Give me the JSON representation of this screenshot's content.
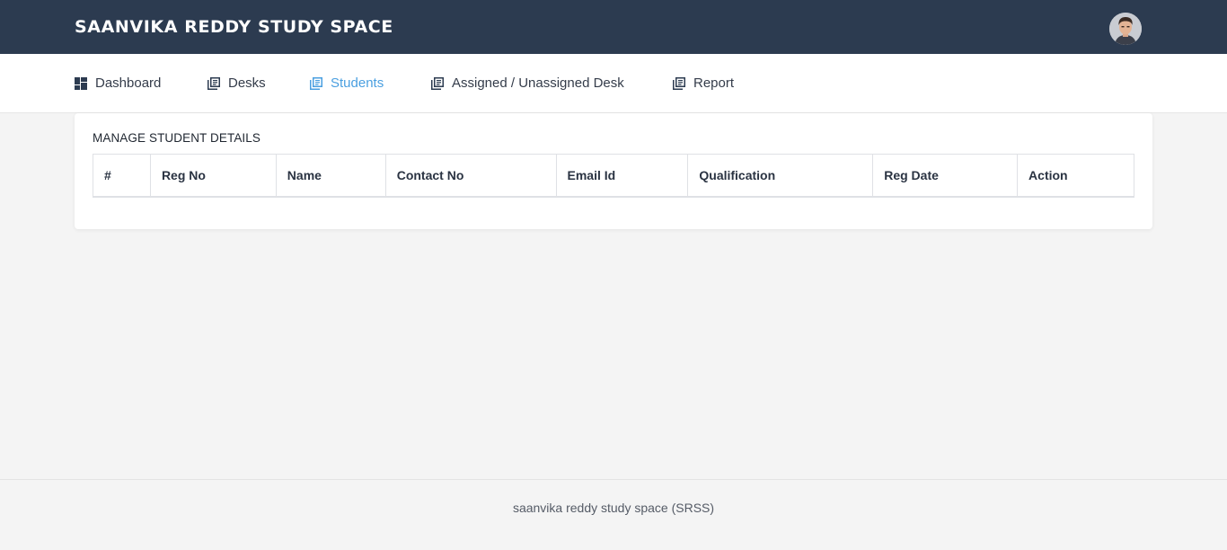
{
  "header": {
    "brand": "SAANVIKA REDDY STUDY SPACE",
    "avatar_icon": "user-avatar",
    "background_color": "#2c3b50"
  },
  "nav": {
    "items": [
      {
        "label": "Dashboard",
        "icon": "dashboard-icon",
        "active": false
      },
      {
        "label": "Desks",
        "icon": "library-books-icon",
        "active": false
      },
      {
        "label": "Students",
        "icon": "library-books-icon",
        "active": true
      },
      {
        "label": "Assigned / Unassigned Desk",
        "icon": "library-books-icon",
        "active": false
      },
      {
        "label": "Report",
        "icon": "library-books-icon",
        "active": false
      }
    ],
    "active_color": "#4a9fe0"
  },
  "main": {
    "card_title": "MANAGE STUDENT DETAILS",
    "table": {
      "columns": [
        "#",
        "Reg No",
        "Name",
        "Contact No",
        "Email Id",
        "Qualification",
        "Reg Date",
        "Action"
      ],
      "rows": []
    }
  },
  "footer": {
    "text": "saanvika reddy study space (SRSS)"
  }
}
